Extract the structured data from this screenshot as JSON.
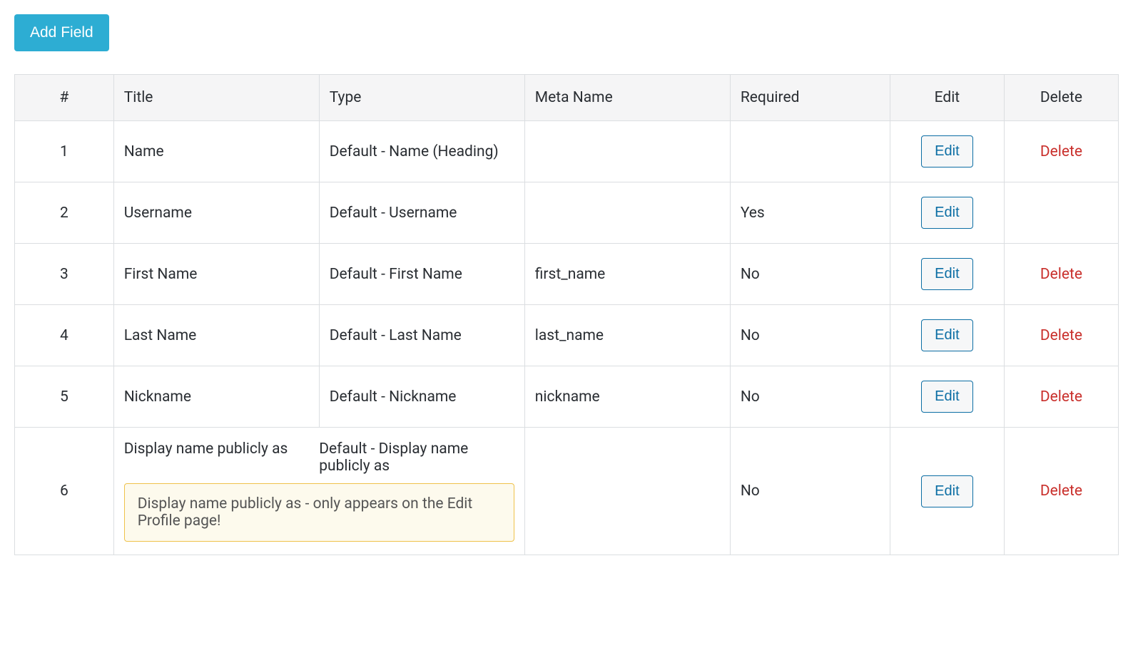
{
  "buttons": {
    "add_field": "Add Field",
    "edit": "Edit",
    "delete": "Delete"
  },
  "headers": {
    "num": "#",
    "title": "Title",
    "type": "Type",
    "meta_name": "Meta Name",
    "required": "Required",
    "edit": "Edit",
    "delete": "Delete"
  },
  "rows": [
    {
      "num": "1",
      "title": "Name",
      "type": "Default - Name (Heading)",
      "meta_name": "",
      "required": "",
      "show_delete": true,
      "notice": ""
    },
    {
      "num": "2",
      "title": "Username",
      "type": "Default - Username",
      "meta_name": "",
      "required": "Yes",
      "show_delete": false,
      "notice": ""
    },
    {
      "num": "3",
      "title": "First Name",
      "type": "Default - First Name",
      "meta_name": "first_name",
      "required": "No",
      "show_delete": true,
      "notice": ""
    },
    {
      "num": "4",
      "title": "Last Name",
      "type": "Default - Last Name",
      "meta_name": "last_name",
      "required": "No",
      "show_delete": true,
      "notice": ""
    },
    {
      "num": "5",
      "title": "Nickname",
      "type": "Default - Nickname",
      "meta_name": "nickname",
      "required": "No",
      "show_delete": true,
      "notice": ""
    },
    {
      "num": "6",
      "title": "Display name publicly as",
      "type": "Default - Display name publicly as",
      "meta_name": "",
      "required": "No",
      "show_delete": true,
      "notice": "Display name publicly as - only appears on the Edit Profile page!"
    }
  ]
}
